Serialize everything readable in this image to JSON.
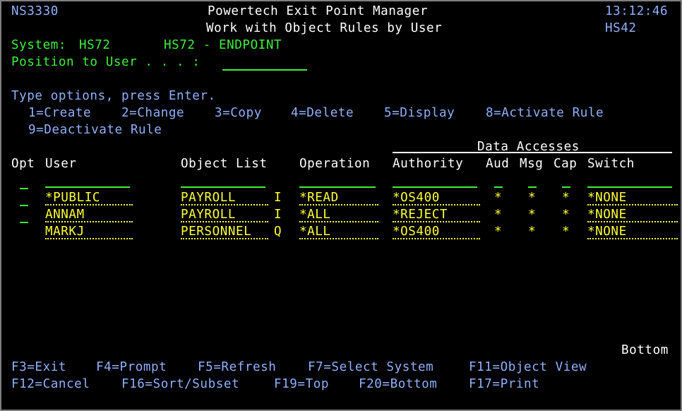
{
  "header": {
    "device": "NS3330",
    "title": "Powertech Exit Point Manager",
    "subtitle": "Work with Object Rules by User",
    "time": "13:12:46",
    "system_id": "HS42"
  },
  "system": {
    "label": "System:",
    "name": "HS72",
    "description": "HS72 - ENDPOINT"
  },
  "position": {
    "label": "Position to User . . . :",
    "value": ""
  },
  "instructions": {
    "text": "Type options, press Enter.",
    "options": [
      "1=Create",
      "2=Change",
      "3=Copy",
      "4=Delete",
      "5=Display",
      "8=Activate Rule",
      "9=Deactivate Rule"
    ]
  },
  "columns": {
    "group": "Data Accesses",
    "opt": "Opt",
    "user": "User",
    "object_list": "Object List",
    "operation": "Operation",
    "authority": "Authority",
    "aud": "Aud",
    "msg": "Msg",
    "cap": "Cap",
    "switch": "Switch"
  },
  "rows": [
    {
      "opt": "_",
      "user": "*PUBLIC",
      "object_list": "PAYROLL",
      "type": "I",
      "operation": "*READ",
      "authority": "*OS400",
      "aud": "*",
      "msg": "*",
      "cap": "*",
      "switch": "*NONE"
    },
    {
      "opt": "_",
      "user": "ANNAM",
      "object_list": "PAYROLL",
      "type": "I",
      "operation": "*ALL",
      "authority": "*REJECT",
      "aud": "*",
      "msg": "*",
      "cap": "*",
      "switch": "*NONE"
    },
    {
      "opt": "_",
      "user": "MARKJ",
      "object_list": "PERSONNEL",
      "type": "Q",
      "operation": "*ALL",
      "authority": "*OS400",
      "aud": "*",
      "msg": "*",
      "cap": "*",
      "switch": "*NONE"
    }
  ],
  "list_status": "Bottom",
  "fkeys_row1": [
    "F3=Exit",
    "F4=Prompt",
    "F5=Refresh",
    "F7=Select System",
    "F11=Object View"
  ],
  "fkeys_row2": [
    "F12=Cancel",
    "F16=Sort/Subset",
    "F19=Top",
    "F20=Bottom",
    "F17=Print"
  ],
  "colors": {
    "background": "#000000",
    "blue": "#8fb0f8",
    "green": "#3cf03c",
    "yellow": "#ffff33",
    "white": "#ffffff",
    "border": "#7f7f7f"
  }
}
